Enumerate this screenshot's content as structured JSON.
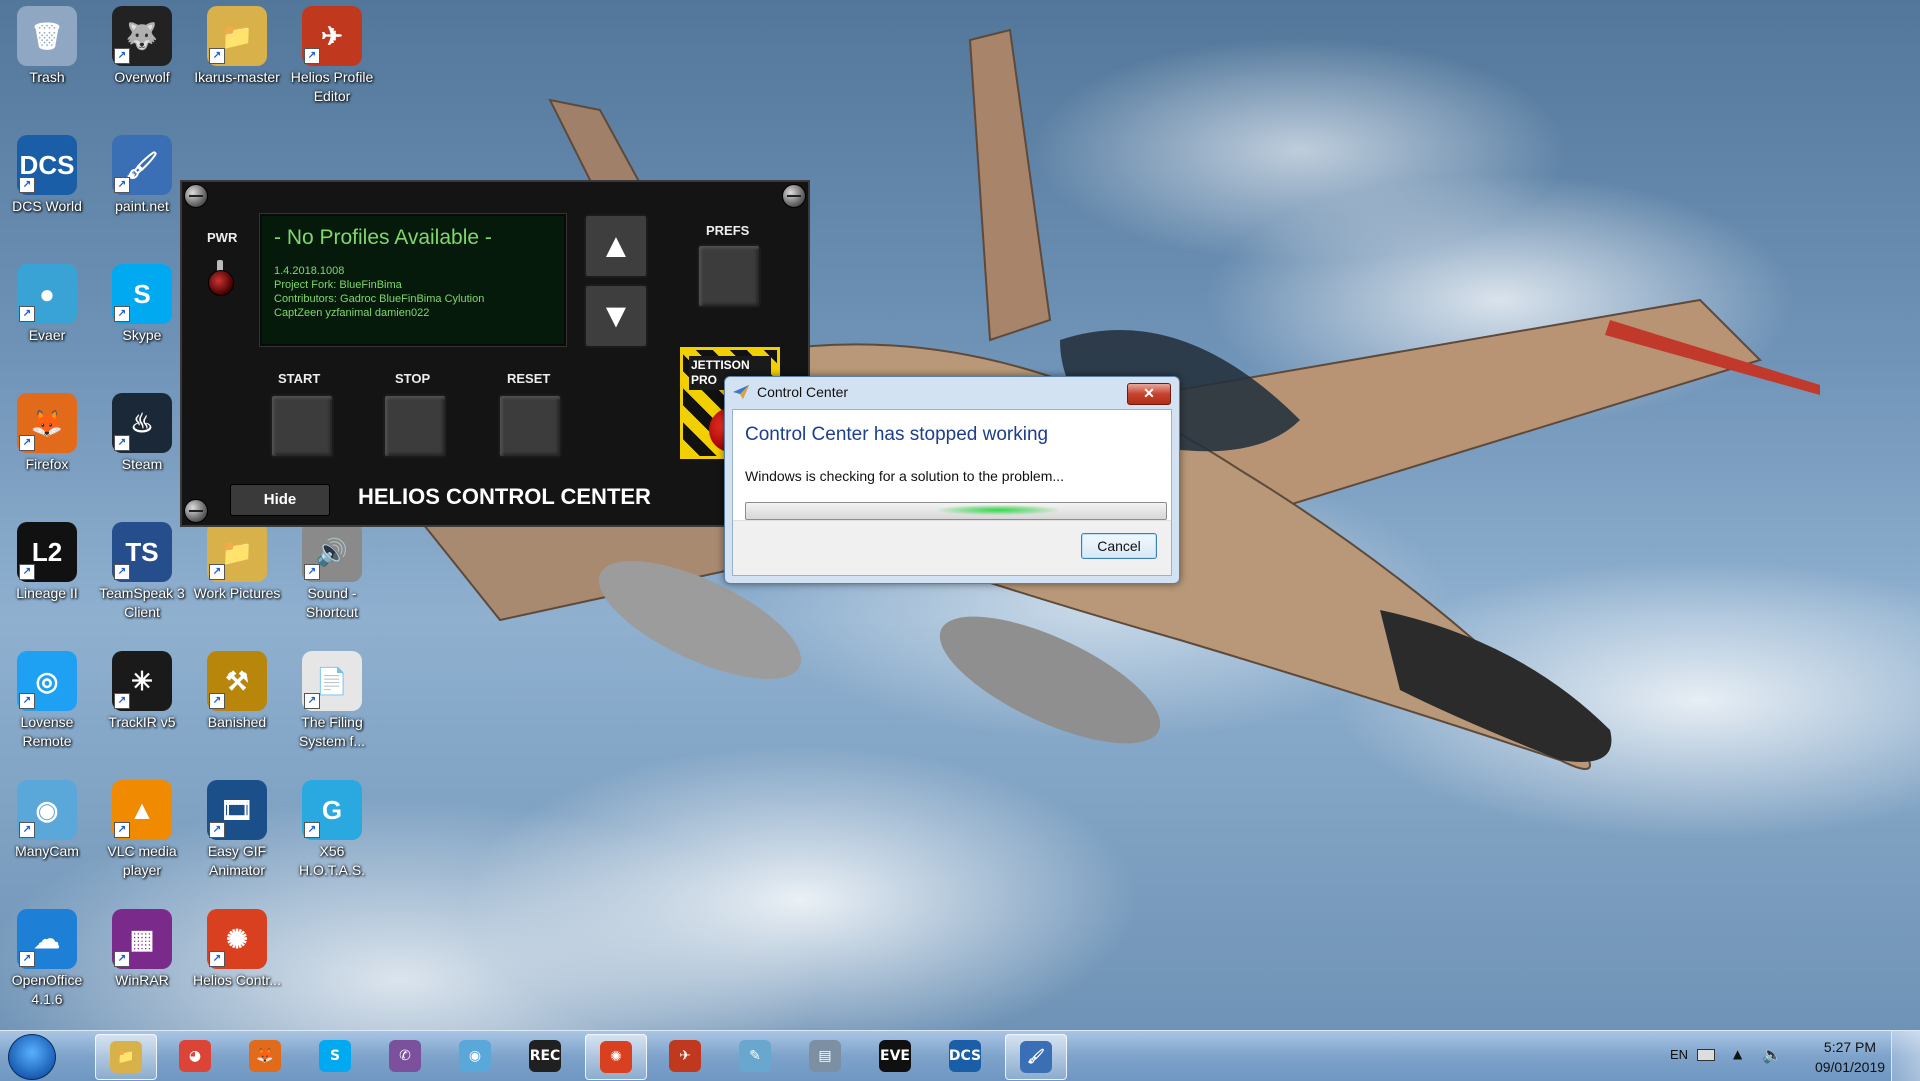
{
  "desktop": {
    "icons": [
      {
        "label": "Trash",
        "glyph": "🗑",
        "color": "#8fa7c2"
      },
      {
        "label": "Overwolf",
        "glyph": "🐺",
        "color": "#222222"
      },
      {
        "label": "Ikarus-master",
        "glyph": "📁",
        "color": "#d8b14a"
      },
      {
        "label": "Helios Profile Editor",
        "glyph": "✈",
        "color": "#c0391e"
      },
      {
        "label": "DCS World",
        "glyph": "DCS",
        "color": "#1a5ea8"
      },
      {
        "label": "paint.net",
        "glyph": "🖌",
        "color": "#3b6fb5"
      },
      {
        "label": "Evaer",
        "glyph": "●",
        "color": "#3aa3d6"
      },
      {
        "label": "Skype",
        "glyph": "S",
        "color": "#00a9f0"
      },
      {
        "label": "Firefox",
        "glyph": "🦊",
        "color": "#e26a1b"
      },
      {
        "label": "Steam",
        "glyph": "♨",
        "color": "#1b2838"
      },
      {
        "label": "Lineage II",
        "glyph": "L2",
        "color": "#111111"
      },
      {
        "label": "TeamSpeak 3 Client",
        "glyph": "TS",
        "color": "#274e8c"
      },
      {
        "label": "Work Pictures",
        "glyph": "📁",
        "color": "#d8b14a"
      },
      {
        "label": "Sound - Shortcut",
        "glyph": "🔊",
        "color": "#8a8a8a"
      },
      {
        "label": "Lovense Remote",
        "glyph": "◎",
        "color": "#1ea1f2"
      },
      {
        "label": "TrackIR v5",
        "glyph": "✳",
        "color": "#1a1a1a"
      },
      {
        "label": "Banished",
        "glyph": "⚒",
        "color": "#b8860b"
      },
      {
        "label": "The Filing System f...",
        "glyph": "📄",
        "color": "#e6e6e6"
      },
      {
        "label": "ManyCam",
        "glyph": "◉",
        "color": "#5aa7d9"
      },
      {
        "label": "VLC media player",
        "glyph": "▲",
        "color": "#f08a00"
      },
      {
        "label": "Easy GIF Animator",
        "glyph": "🎞",
        "color": "#1b4f8a"
      },
      {
        "label": "X56 H.O.T.A.S.",
        "glyph": "G",
        "color": "#2aa8e0"
      },
      {
        "label": "OpenOffice 4.1.6",
        "glyph": "☁",
        "color": "#1d7fd6"
      },
      {
        "label": "WinRAR",
        "glyph": "▦",
        "color": "#7a2a8a"
      },
      {
        "label": "Helios Contr...",
        "glyph": "✺",
        "color": "#d9401f"
      }
    ]
  },
  "helios": {
    "pwr_label": "PWR",
    "prefs_label": "PREFS",
    "display_title": "- No Profiles Available -",
    "version": "1.4.2018.1008",
    "fork": "Project Fork: BlueFinBima",
    "contributors": "Contributors: Gadroc BlueFinBima Cylution",
    "contributors2": "CaptZeen yzfanimal damien022",
    "start_label": "START",
    "stop_label": "STOP",
    "reset_label": "RESET",
    "hide_label": "Hide",
    "title": "HELIOS CONTROL CENTER",
    "jettison_label": "JETTISON PRO",
    "up_arrow": "▲",
    "down_arrow": "▼"
  },
  "dialog": {
    "title": "Control Center",
    "close_glyph": "✕",
    "heading": "Control Center has stopped working",
    "message": "Windows is checking for a solution to the problem...",
    "cancel_label": "Cancel",
    "progress_glow_fraction": 0.6
  },
  "taskbar": {
    "items": [
      {
        "name": "explorer",
        "glyph": "📁",
        "color": "#d8b14a",
        "active": true
      },
      {
        "name": "chrome",
        "glyph": "◕",
        "color": "#db4437",
        "active": false
      },
      {
        "name": "firefox",
        "glyph": "🦊",
        "color": "#e26a1b",
        "active": false
      },
      {
        "name": "skype",
        "glyph": "S",
        "color": "#00a9f0",
        "active": false
      },
      {
        "name": "viber",
        "glyph": "✆",
        "color": "#7b519d",
        "active": false
      },
      {
        "name": "manycam",
        "glyph": "◉",
        "color": "#5aa7d9",
        "active": false
      },
      {
        "name": "screen-recorder",
        "glyph": "REC",
        "color": "#202020",
        "active": false
      },
      {
        "name": "helios-control-center",
        "glyph": "✺",
        "color": "#d9401f",
        "active": true
      },
      {
        "name": "helios-profile-editor",
        "glyph": "✈",
        "color": "#c0391e",
        "active": false
      },
      {
        "name": "notepad",
        "glyph": "✎",
        "color": "#6aa7cf",
        "active": false
      },
      {
        "name": "calculator",
        "glyph": "▤",
        "color": "#7d8fa3",
        "active": false
      },
      {
        "name": "eve",
        "glyph": "EVE",
        "color": "#101010",
        "active": false
      },
      {
        "name": "dcs",
        "glyph": "DCS",
        "color": "#1a5ea8",
        "active": false
      },
      {
        "name": "paint-net",
        "glyph": "🖌",
        "color": "#3b6fb5",
        "active": true
      }
    ],
    "lang": "EN",
    "time": "5:27 PM",
    "date": "09/01/2019"
  }
}
